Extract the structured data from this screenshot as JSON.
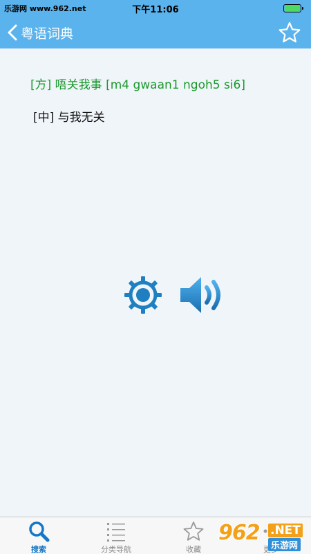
{
  "status_bar": {
    "left_text": "乐游网 www.962.net",
    "time": "下午11:06"
  },
  "nav_bar": {
    "back_label": "粤语词典",
    "back_icon": "chevron-left-icon",
    "favorite_icon": "star-outline-icon"
  },
  "entry": {
    "term": "[方] 唔关我事 [m4 gwaan1 ngoh5 si6]",
    "definition": "[中] 与我无关"
  },
  "actions": {
    "settings_icon": "gear-icon",
    "audio_icon": "speaker-icon"
  },
  "tab_bar": {
    "tabs": [
      {
        "label": "搜索",
        "icon": "search-icon",
        "active": true
      },
      {
        "label": "分类导航",
        "icon": "list-icon",
        "active": false
      },
      {
        "label": "收藏",
        "icon": "star-icon",
        "active": false
      },
      {
        "label": "更多",
        "icon": "more-icon",
        "active": false
      }
    ]
  },
  "watermark": {
    "brand_number": "962",
    "brand_suffix": ".NET",
    "brand_cn": "乐游网"
  },
  "colors": {
    "header": "#5ab3ec",
    "term_green": "#1a9a2b",
    "icon_blue": "#1f7fc1",
    "tab_active": "#1577c7",
    "background": "#f0f5fa"
  }
}
